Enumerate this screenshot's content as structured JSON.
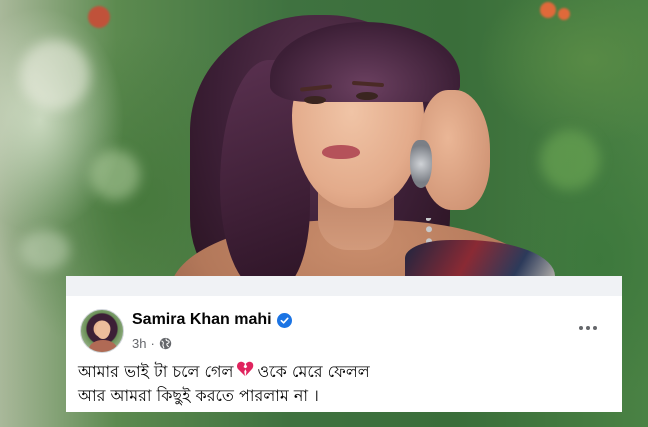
{
  "post": {
    "author": {
      "name": "Samira Khan mahi",
      "verified": true
    },
    "timestamp": "3h",
    "separator": "·",
    "audience_icon": "globe-icon",
    "more_icon": "more-options-icon",
    "text": {
      "line1_before_emoji": "আমার ভাই টা চলে গেল",
      "line1_emoji": "broken-heart-icon",
      "line1_after_emoji": "ওকে মেরে ফেলল",
      "line2": "আর আমরা কিছুই করতে পারলাম না ।"
    }
  },
  "colors": {
    "card_background": "#ffffff",
    "name_text": "#050505",
    "meta_text": "#65676b",
    "verified_badge": "#1b74e4",
    "broken_heart": "#e0245e"
  }
}
